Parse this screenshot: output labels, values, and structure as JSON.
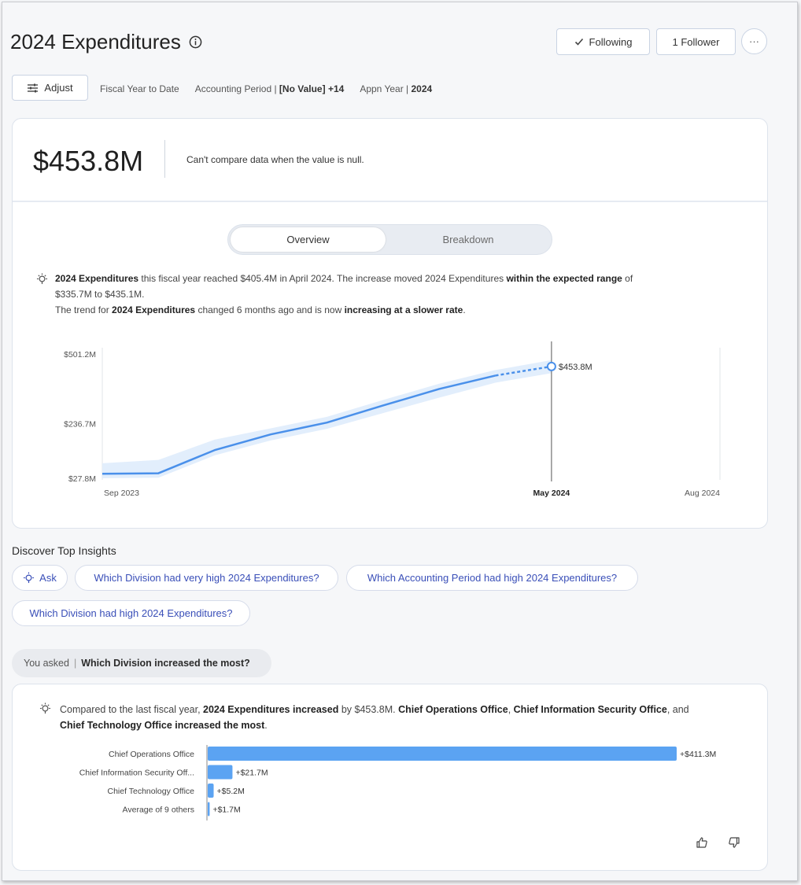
{
  "header": {
    "title": "2024 Expenditures",
    "following_label": "Following",
    "follower_label": "1 Follower",
    "more_label": "···"
  },
  "filters": {
    "adjust_label": "Adjust",
    "period_label": "Fiscal Year to Date",
    "accounting_name": "Accounting Period | ",
    "accounting_value": "[No Value]",
    "accounting_extra": " +14",
    "appn_name": "Appn Year | ",
    "appn_value": "2024"
  },
  "kpi": {
    "value": "$453.8M",
    "note": "Can't compare data when the value is null."
  },
  "tabs": {
    "overview": "Overview",
    "breakdown": "Breakdown"
  },
  "summary": {
    "line1_bold": "2024 Expenditures",
    "line1_text": " this fiscal year reached $405.4M in April 2024. The increase moved 2024 Expenditures ",
    "line1_bold2": "within the expected range",
    "line1_end": " of",
    "line2": "$335.7M to $435.1M.",
    "line3_a": "The trend for ",
    "line3_bold": "2024 Expenditures",
    "line3_b": " changed 6 months ago and is now ",
    "line3_bold2": "increasing at a slower rate",
    "line3_end": "."
  },
  "chart_data": {
    "type": "line",
    "y_tick_labels": [
      "$501.2M",
      "$236.7M",
      "$27.8M"
    ],
    "y_ticks": [
      501.2,
      236.7,
      27.8
    ],
    "ylim": [
      27.8,
      501.2
    ],
    "x_tick_labels": [
      "Sep 2023",
      "May 2024",
      "Aug 2024"
    ],
    "x_ticks": [
      "2023-09",
      "2024-05",
      "2024-08"
    ],
    "xlim": [
      "2023-09",
      "2024-08"
    ],
    "series": [
      {
        "x": [
          "2023-09",
          "2023-10",
          "2023-11",
          "2023-12",
          "2024-01",
          "2024-02",
          "2024-03",
          "2024-04"
        ],
        "values": [
          45,
          47,
          135,
          195,
          240,
          305,
          368,
          419
        ]
      },
      {
        "style": "dashed",
        "x": [
          "2024-04",
          "2024-05"
        ],
        "values": [
          419,
          453.8
        ]
      }
    ],
    "band_lower": [
      28,
      30,
      115,
      172,
      216,
      276,
      335,
      392,
      428
    ],
    "band_upper": [
      85,
      98,
      175,
      218,
      262,
      326,
      388,
      440,
      478
    ],
    "marker_label": "$453.8M",
    "marker_x": "2024-05",
    "marker_value": 453.8,
    "accent_color": "#4a90ea",
    "band_color": "#e2eefc"
  },
  "discover": {
    "title": "Discover Top Insights",
    "ask_label": "Ask",
    "q1": "Which Division had very high 2024 Expenditures?",
    "q2": "Which Accounting Period had high 2024 Expenditures?",
    "q3": "Which Division had high 2024 Expenditures?"
  },
  "asked": {
    "prefix": "You asked",
    "question": "Which Division increased the most?"
  },
  "answer": {
    "a1": "Compared to the last fiscal year, ",
    "b1": "2024 Expenditures increased",
    "a2": " by $453.8M. ",
    "b2": "Chief Operations Office",
    "a3": ", ",
    "b3": "Chief Information Security Office",
    "a4": ", and",
    "b4": "Chief Technology Office increased the most",
    "a5": "."
  },
  "bar_chart": {
    "type": "bar",
    "categories": [
      "Chief Operations Office",
      "Chief Information Security Off...",
      "Chief Technology Office",
      "Average of 9 others"
    ],
    "values": [
      411.3,
      21.7,
      5.2,
      1.7
    ],
    "labels": [
      "+$411.3M",
      "+$21.7M",
      "+$5.2M",
      "+$1.7M"
    ],
    "color": "#5ba3f2"
  }
}
